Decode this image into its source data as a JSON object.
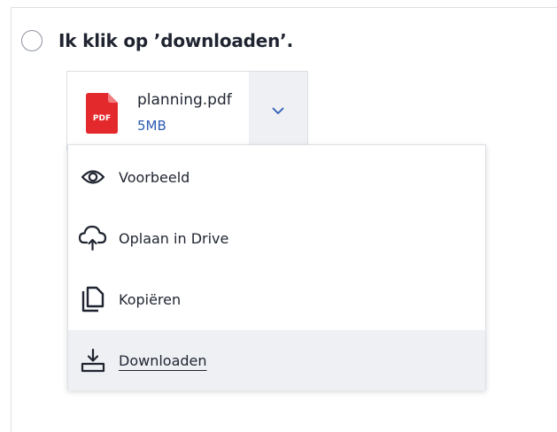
{
  "question": {
    "option_text": "Ik klik op ’downloaden’."
  },
  "file": {
    "icon_label": "PDF",
    "name": "planning.pdf",
    "size": "5MB"
  },
  "menu": {
    "items": [
      {
        "label": "Voorbeeld",
        "icon": "eye-icon"
      },
      {
        "label": "Oplaan in Drive",
        "icon": "cloud-upload-icon"
      },
      {
        "label": "Kopiëren",
        "icon": "copy-icon"
      },
      {
        "label": "Downloaden",
        "icon": "download-icon",
        "highlighted": true
      }
    ]
  },
  "colors": {
    "pdf_red": "#e4292d",
    "link_blue": "#2e5bb4",
    "hover_bg": "#eef0f4",
    "border": "#dcdfe4"
  }
}
